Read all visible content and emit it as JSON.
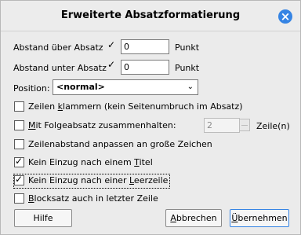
{
  "dialog": {
    "title": "Erweiterte Absatzformatierung",
    "close_icon": "close-icon"
  },
  "spacing": {
    "above_label": "Abstand über Absatz",
    "above_checked": true,
    "above_value": "0",
    "above_unit": "Punkt",
    "below_label": "Abstand unter Absatz",
    "below_checked": true,
    "below_value": "0",
    "below_unit": "Punkt"
  },
  "position": {
    "label": "Position:",
    "selected": "<normal>"
  },
  "options": {
    "keep_lines": {
      "pre": "Zeilen ",
      "underlined": "k",
      "post": "lammern (kein Seitenumbruch im Absatz)",
      "checked": false
    },
    "keep_next": {
      "underlined": "M",
      "post": "it Folgeabsatz zusammenhalten:",
      "checked": false,
      "value": "2",
      "unit": "Zeile(n)"
    },
    "adjust_spacing": {
      "label": "Zeilenabstand anpassen an große Zeichen",
      "checked": false
    },
    "no_indent_title": {
      "pre": "Kein Einzug nach einem ",
      "underlined": "T",
      "post": "itel",
      "checked": true
    },
    "no_indent_blank": {
      "pre": "Kein Einzug nach einer ",
      "underlined": "L",
      "post": "eerzeile",
      "checked": true
    },
    "justify_last": {
      "underlined": "B",
      "post": "locksatz auch in letzter Zeile",
      "checked": false
    }
  },
  "buttons": {
    "help": "Hilfe",
    "cancel_underlined": "A",
    "cancel_rest": "bbrechen",
    "apply_underlined": "Ü",
    "apply_rest": "bernehmen"
  }
}
